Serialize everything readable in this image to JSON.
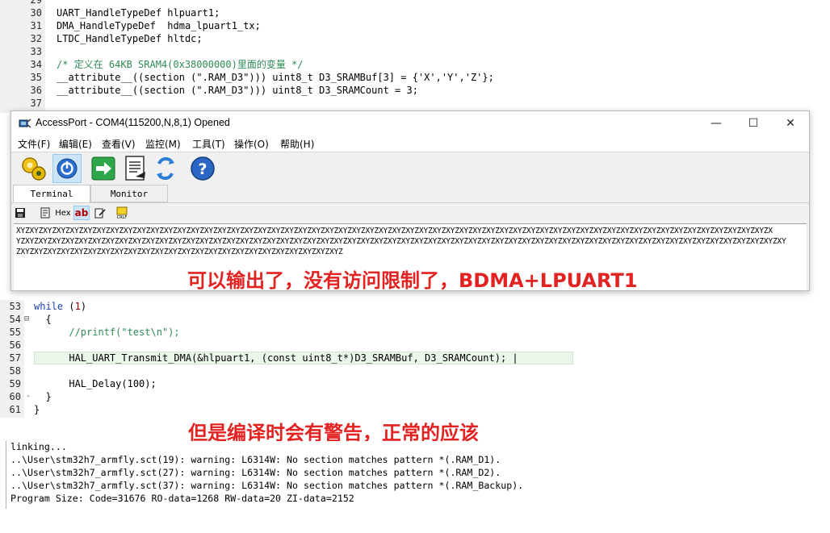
{
  "code_top": {
    "lines": [
      {
        "no": "29",
        "text": ""
      },
      {
        "no": "30",
        "text": "UART_HandleTypeDef hlpuart1;"
      },
      {
        "no": "31",
        "text": "DMA_HandleTypeDef  hdma_lpuart1_tx;"
      },
      {
        "no": "32",
        "text": "LTDC_HandleTypeDef hltdc;"
      },
      {
        "no": "33",
        "text": ""
      },
      {
        "no": "34",
        "text": "/* 定义在 64KB SRAM4(0x38000000)里面的变量 */"
      },
      {
        "no": "35",
        "text": "__attribute__((section (\".RAM_D3\"))) uint8_t D3_SRAMBuf[3] = {'X','Y','Z'};"
      },
      {
        "no": "36",
        "text": "__attribute__((section (\".RAM_D3\"))) uint8_t D3_SRAMCount = 3;"
      },
      {
        "no": "37",
        "text": ""
      }
    ]
  },
  "window": {
    "title": "AccessPort - COM4(115200,N,8,1) Opened",
    "menus": [
      "文件(F)",
      "编辑(E)",
      "查看(V)",
      "监控(M)",
      "工具(T)",
      "操作(O)",
      "帮助(H)"
    ],
    "minimize": "—",
    "maximize": "☐",
    "close": "✕",
    "toolbar_icons": [
      "settings-gear-icon",
      "power-icon",
      "send-arrow-icon",
      "document-icon",
      "refresh-icon",
      "help-icon"
    ],
    "tabs": [
      "Terminal",
      "Monitor"
    ],
    "sub_toolbar": {
      "hex": "Hex",
      "ab": "ab"
    },
    "terminal_lines": [
      "XYZXYZXYZXYZXYZXYZXYZXYZXYZXYZXYZXYZXYZXYZXYZXYZXYZXYZXYZXYZXYZXYZXYZXYZXYZXYZXYZXYZXYZXYZXYZXYZXYZXYZXYZXYZXYZXYZXYZXYZXYZXYZXYZXYZXYZXYZXYZXYZXYZXYZXYZXYZXYZXYZXYZXYZX",
      "YZXYZXYZXYZXYZXYZXYZXYZXYZXYZXYZXYZXYZXYZXYZXYZXYZXYZXYZXYZXYZXYZXYZXYZXYZXYZXYZXYZXYZXYZXYZXYZXYZXYZXYZXYZXYZXYZXYZXYZXYZXYZXYZXYZXYZXYZXYZXYZXYZXYZXYZXYZXYZXYZXYZXYZXYZXY",
      "ZXYZXYZXYZXYZXYZXYZXYZXYZXYZXYZXYZXYZXYZXYZXYZXYZXYZXYZXYZXYZXYZXYZXYZXYZ"
    ]
  },
  "annotations": {
    "note1": "可以输出了，没有访问限制了，BDMA+LPUART1",
    "note2": "但是编译时会有警告，正常的应该"
  },
  "code_bottom": {
    "lines": [
      {
        "no": "53",
        "fold": "",
        "text": "  while (1)"
      },
      {
        "no": "54",
        "fold": "⊟",
        "text": "  {"
      },
      {
        "no": "55",
        "fold": "",
        "text": "      //printf(\"test\\n\");"
      },
      {
        "no": "56",
        "fold": "",
        "text": ""
      },
      {
        "no": "57",
        "fold": "",
        "text": "      HAL_UART_Transmit_DMA(&hlpuart1, (const uint8_t*)D3_SRAMBuf, D3_SRAMCount); |"
      },
      {
        "no": "58",
        "fold": "",
        "text": ""
      },
      {
        "no": "59",
        "fold": "",
        "text": "      HAL_Delay(100);"
      },
      {
        "no": "60",
        "fold": "-",
        "text": "  }"
      },
      {
        "no": "61",
        "fold": "",
        "text": "}"
      }
    ]
  },
  "build_output": {
    "lines": [
      "linking...",
      "..\\User\\stm32h7_armfly.sct(19): warning: L6314W: No section matches pattern *(.RAM_D1).",
      "..\\User\\stm32h7_armfly.sct(27): warning: L6314W: No section matches pattern *(.RAM_D2).",
      "..\\User\\stm32h7_armfly.sct(37): warning: L6314W: No section matches pattern *(.RAM_Backup).",
      "Program Size: Code=31676 RO-data=1268 RW-data=20 ZI-data=2152"
    ]
  },
  "colors": {
    "annotation_red": "#e32222",
    "comment_green": "#2e8b57",
    "string_purple": "#7a0e80",
    "keyword_blue": "#1c3fae",
    "highlight_line": "#eaf6ea"
  }
}
